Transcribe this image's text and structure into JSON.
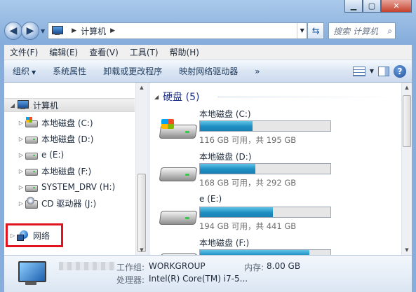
{
  "address": {
    "location": "计算机"
  },
  "search": {
    "placeholder": "搜索 计算机"
  },
  "menu": [
    "文件(F)",
    "编辑(E)",
    "查看(V)",
    "工具(T)",
    "帮助(H)"
  ],
  "toolbar": {
    "organize": "组织",
    "system_properties": "系统属性",
    "uninstall": "卸载或更改程序",
    "map_drive": "映射网络驱动器",
    "more": "»"
  },
  "nav": {
    "computer": "计算机",
    "drives": [
      "本地磁盘 (C:)",
      "本地磁盘 (D:)",
      "e (E:)",
      "本地磁盘 (F:)",
      "SYSTEM_DRV (H:)",
      "CD 驱动器 (J:)"
    ],
    "network": "网络"
  },
  "content": {
    "group_header": "硬盘 (5)",
    "drives": [
      {
        "name": "本地磁盘 (C:)",
        "free": "116 GB 可用，共 195 GB",
        "used_fraction": 0.405,
        "system": true
      },
      {
        "name": "本地磁盘 (D:)",
        "free": "168 GB 可用，共 292 GB",
        "used_fraction": 0.425,
        "system": false
      },
      {
        "name": "e (E:)",
        "free": "194 GB 可用，共 441 GB",
        "used_fraction": 0.56,
        "system": false
      },
      {
        "name": "本地磁盘 (F:)",
        "free": "",
        "used_fraction": 0.84,
        "system": false
      }
    ]
  },
  "details": {
    "workgroup_label": "工作组:",
    "workgroup": "WORKGROUP",
    "memory_label": "内存:",
    "memory": "8.00 GB",
    "processor_label": "处理器:",
    "processor": "Intel(R) Core(TM) i7-5..."
  },
  "icons": {
    "back": "back-arrow-icon",
    "forward": "forward-arrow-icon",
    "refresh": "refresh-icon",
    "search": "search-icon",
    "help": "help-icon"
  }
}
